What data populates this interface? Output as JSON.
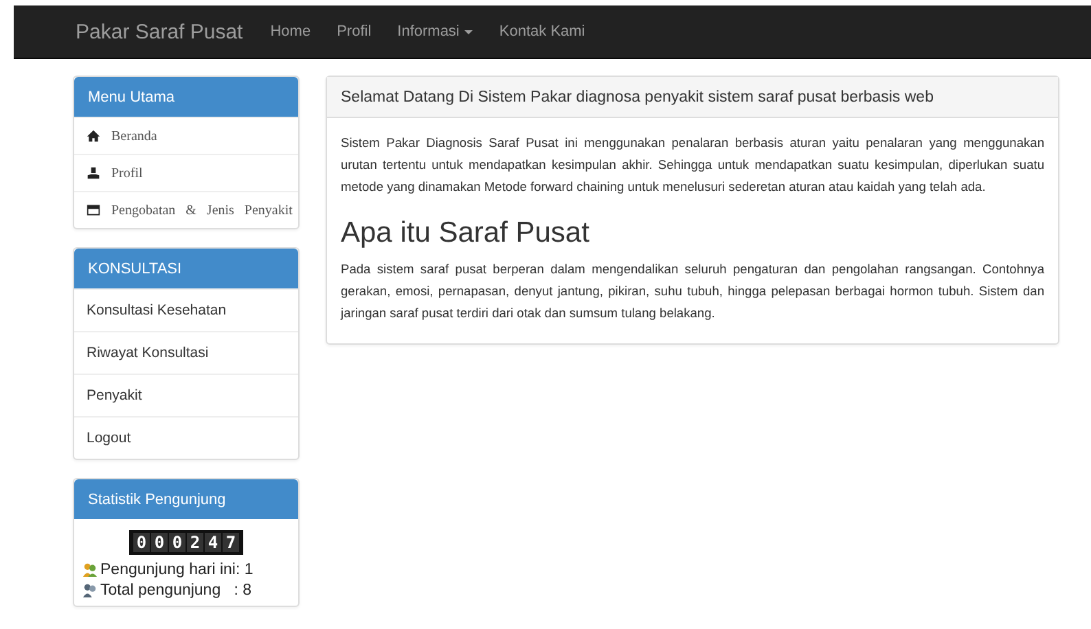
{
  "navbar": {
    "brand": "Pakar Saraf Pusat",
    "links": [
      {
        "label": "Home",
        "dropdown": false
      },
      {
        "label": "Profil",
        "dropdown": false
      },
      {
        "label": "Informasi",
        "dropdown": true
      },
      {
        "label": "Kontak Kami",
        "dropdown": false
      }
    ]
  },
  "sidebar": {
    "main_menu": {
      "title": "Menu Utama",
      "items": [
        {
          "label": "Beranda",
          "kind": "home"
        },
        {
          "label": "Profil",
          "kind": "user"
        },
        {
          "label": "Pengobatan & Jenis Penyakit",
          "kind": "card"
        }
      ]
    },
    "consultation": {
      "title": "KONSULTASI",
      "items": [
        "Konsultasi Kesehatan",
        "Riwayat Konsultasi",
        "Penyakit",
        "Logout"
      ]
    },
    "stats": {
      "title": "Statistik Pengunjung",
      "counter": [
        "0",
        "0",
        "0",
        "2",
        "4",
        "7"
      ],
      "lines": [
        {
          "text": "Pengunjung hari ini: 1",
          "kind": "today"
        },
        {
          "text": "Total pengunjung   : 8",
          "kind": "total"
        }
      ]
    }
  },
  "content": {
    "heading": "Selamat Datang Di Sistem Pakar diagnosa penyakit sistem saraf pusat berbasis web",
    "intro": "Sistem Pakar Diagnosis Saraf Pusat ini menggunakan penalaran berbasis aturan yaitu penalaran yang menggunakan urutan tertentu untuk mendapatkan kesimpulan akhir. Sehingga untuk mendapatkan suatu kesimpulan, diperlukan suatu metode yang dinamakan Metode forward chaining untuk menelusuri sederetan aturan atau kaidah yang telah ada.",
    "title": "Apa itu Saraf Pusat",
    "body": "Pada sistem saraf pusat berperan dalam mengendalikan seluruh pengaturan dan pengolahan rangsangan. Contohnya gerakan, emosi, pernapasan, denyut jantung, pikiran, suhu tubuh, hingga pelepasan berbagai hormon tubuh. Sistem dan jaringan saraf pusat terdiri dari otak dan sumsum tulang belakang."
  }
}
